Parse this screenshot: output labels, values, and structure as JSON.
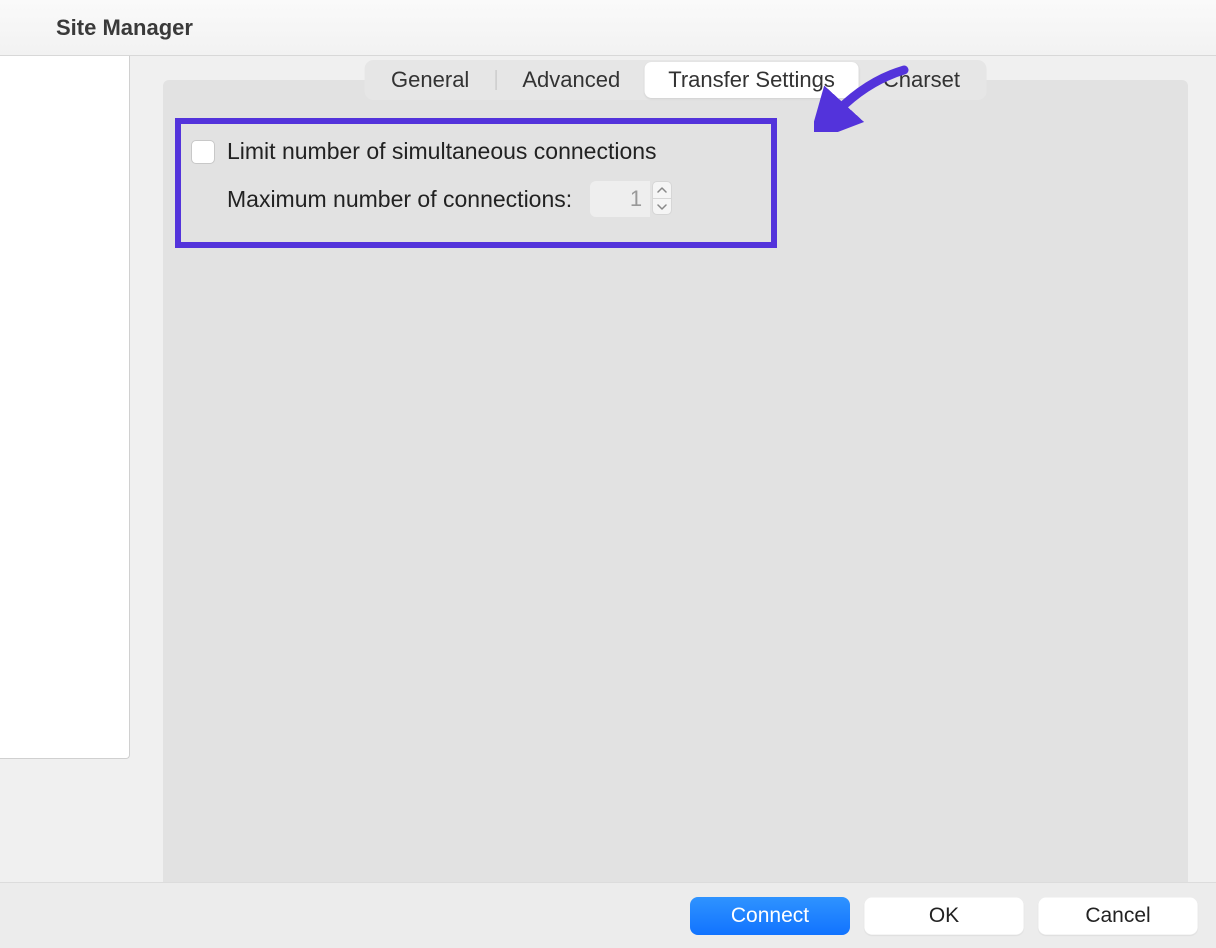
{
  "window": {
    "title": "Site Manager"
  },
  "tabs": {
    "general": "General",
    "advanced": "Advanced",
    "transfer": "Transfer Settings",
    "charset": "Charset",
    "active_index": 2
  },
  "settings": {
    "limit_connections_label": "Limit number of simultaneous connections",
    "limit_connections_checked": false,
    "max_connections_label": "Maximum number of connections:",
    "max_connections_value": "1"
  },
  "footer": {
    "connect": "Connect",
    "ok": "OK",
    "cancel": "Cancel"
  },
  "annotation": {
    "highlight_color": "#5333db",
    "arrow_color": "#5333db"
  }
}
